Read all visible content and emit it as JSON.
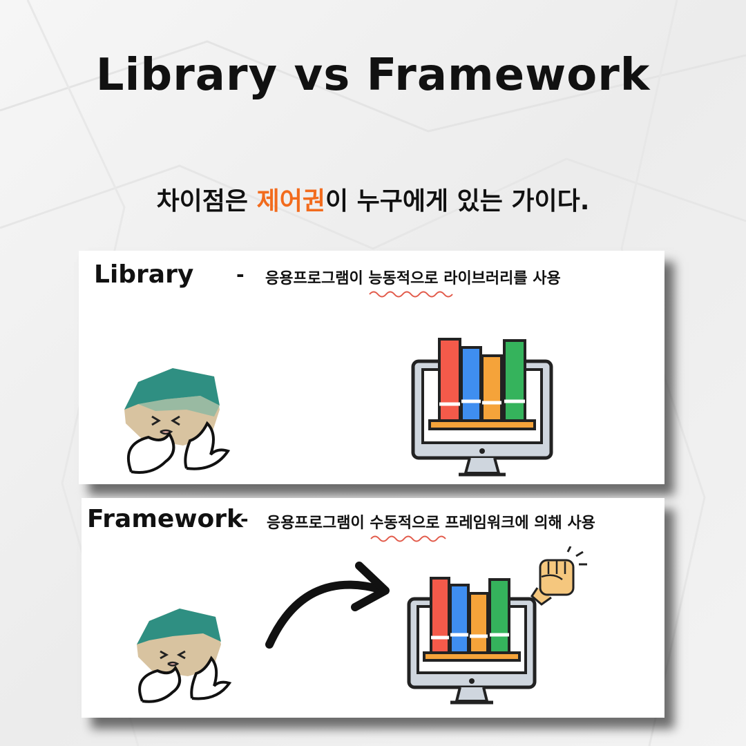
{
  "title": "Library vs Framework",
  "subtitle": {
    "before": "차이점은 ",
    "highlight": "제어권",
    "after": "이 누구에게 있는 가이다.",
    "highlight_color": "#f26b1d"
  },
  "library": {
    "label": "Library",
    "dash": "-",
    "desc_before": "응용프로그램이 ",
    "desc_underlined": "능동적으로",
    "desc_after": " 라이브러리를 사용"
  },
  "framework": {
    "label": "Framework",
    "dash": "-",
    "desc_before": "응용프로그램이 ",
    "desc_underlined": "수동적으로",
    "desc_after": " 프레임워크에 의해 사용"
  },
  "icons": {
    "character": "doodle-character-icon",
    "library_monitor": "bookshelf-monitor-icon",
    "arrow": "curved-arrow-icon",
    "fist": "raised-fist-icon"
  },
  "colors": {
    "book_red": "#f45a4a",
    "book_blue": "#3f8ef0",
    "book_orange": "#f5a33a",
    "book_green": "#35b35c",
    "squiggle": "#e25a4a"
  }
}
